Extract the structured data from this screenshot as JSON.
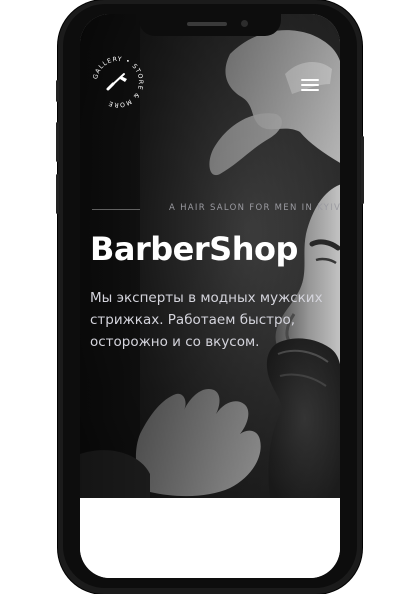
{
  "brand": {
    "logo_ring_text": "GALLERY • STORE & MORE",
    "logo_icon": "razor-icon"
  },
  "header": {
    "menu_icon": "hamburger-menu-icon"
  },
  "hero": {
    "tagline": "A HAIR SALON FOR MEN IN KYIV",
    "title": "BarberShop",
    "subtitle_lines": [
      "Мы эксперты в модных мужских",
      "стрижках. Работаем быстро,",
      "осторожно и со вкусом."
    ]
  },
  "colors": {
    "title": "#ffffff",
    "tagline": "#9a9aa0",
    "subtitle": "#d4d4dc",
    "phone_frame": "#1b1b1b"
  }
}
